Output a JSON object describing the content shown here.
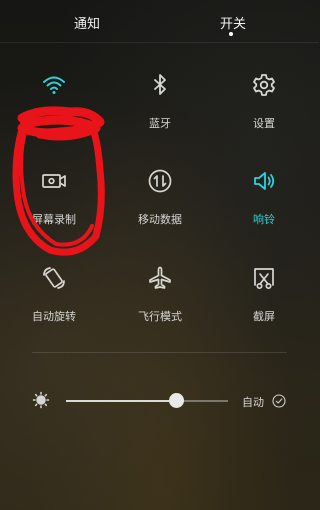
{
  "tabs": {
    "notify": "通知",
    "switches": "开关",
    "active": "switches"
  },
  "toggles": [
    {
      "id": "wifi",
      "label": "",
      "icon": "wifi-icon",
      "active": true
    },
    {
      "id": "bluetooth",
      "label": "蓝牙",
      "icon": "bluetooth-icon",
      "active": false
    },
    {
      "id": "settings",
      "label": "设置",
      "icon": "gear-icon",
      "active": false
    },
    {
      "id": "screen-record",
      "label": "屏幕录制",
      "icon": "video-camera-icon",
      "active": false
    },
    {
      "id": "mobile-data",
      "label": "移动数据",
      "icon": "mobile-data-icon",
      "active": false
    },
    {
      "id": "sound",
      "label": "响铃",
      "icon": "speaker-icon",
      "active": true
    },
    {
      "id": "auto-rotate",
      "label": "自动旋转",
      "icon": "rotate-icon",
      "active": false
    },
    {
      "id": "airplane",
      "label": "飞行模式",
      "icon": "airplane-icon",
      "active": false
    },
    {
      "id": "screenshot",
      "label": "截屏",
      "icon": "screenshot-icon",
      "active": false
    }
  ],
  "brightness": {
    "level": 0.68,
    "auto_label": "自动",
    "auto_checked": false
  },
  "colors": {
    "accent": "#2dd3dc",
    "scribble": "#e8141a"
  }
}
